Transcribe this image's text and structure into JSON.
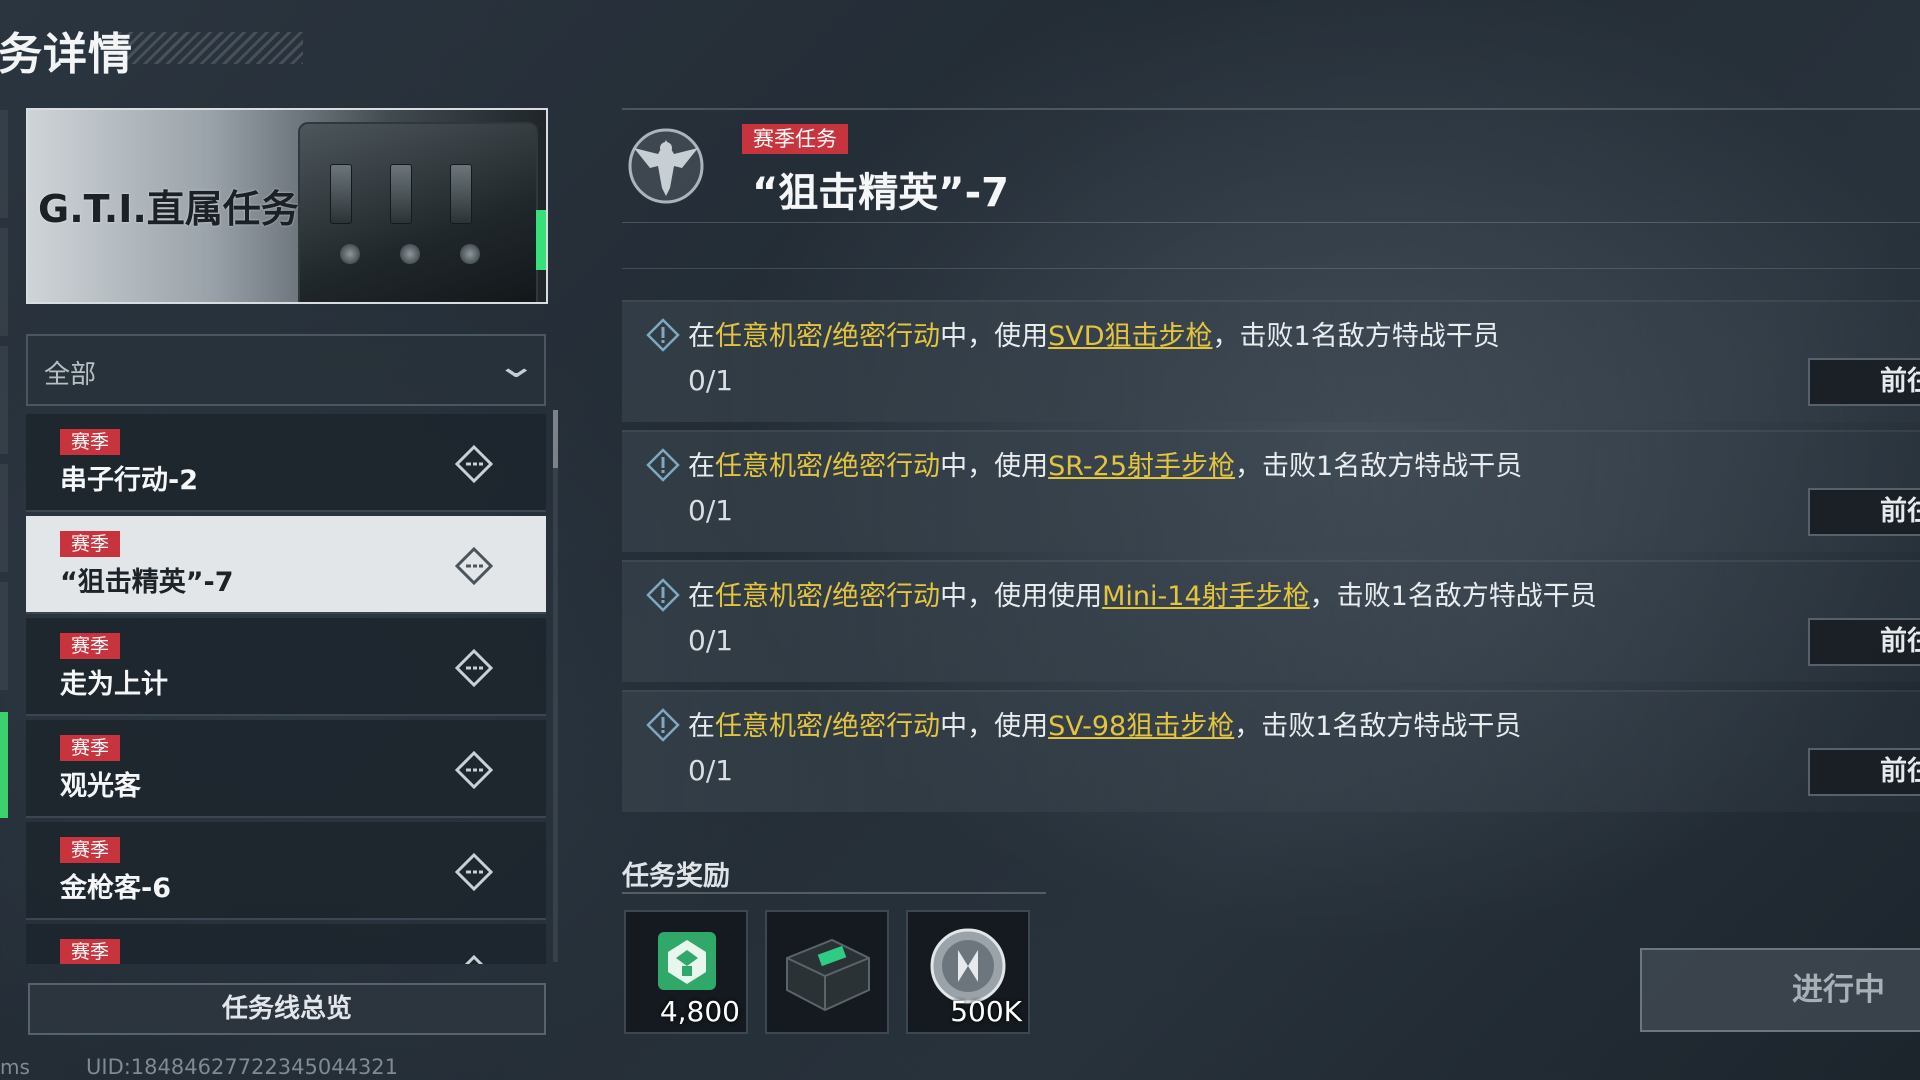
{
  "page": {
    "title": "务详情"
  },
  "banner": {
    "title": "G.T.I.直属任务"
  },
  "filter": {
    "selected": "全部"
  },
  "missions": [
    {
      "badge": "赛季",
      "name": "串子行动-2"
    },
    {
      "badge": "赛季",
      "name": "“狙击精英”-7"
    },
    {
      "badge": "赛季",
      "name": "走为上计"
    },
    {
      "badge": "赛季",
      "name": "观光客"
    },
    {
      "badge": "赛季",
      "name": "金枪客-6"
    },
    {
      "badge": "赛季",
      "name": ""
    }
  ],
  "overview_button": "任务线总览",
  "uid": "UID:18484627722345044321",
  "ms_label": "ms",
  "detail": {
    "badge": "赛季任务",
    "title": "“狙击精英”-7"
  },
  "objectives": [
    {
      "t1": "在",
      "t2": "任意机密/绝密行动",
      "t3": "中，使用",
      "weapon": "SVD狙击步枪",
      "t4": "，击败1名敌方特战干员",
      "progress": "0/1",
      "go": "前往"
    },
    {
      "t1": "在",
      "t2": "任意机密/绝密行动",
      "t3": "中，使用",
      "weapon": "SR-25射手步枪",
      "t4": "，击败1名敌方特战干员",
      "progress": "0/1",
      "go": "前往"
    },
    {
      "t1": "在",
      "t2": "任意机密/绝密行动",
      "t3": "中，使用使用",
      "weapon": "Mini-14射手步枪",
      "t4": "，击败1名敌方特战干员",
      "progress": "0/1",
      "go": "前往"
    },
    {
      "t1": "在",
      "t2": "任意机密/绝密行动",
      "t3": "中，使用",
      "weapon": "SV-98狙击步枪",
      "t4": "，击败1名敌方特战干员",
      "progress": "0/1",
      "go": "前往"
    }
  ],
  "rewards": {
    "title": "任务奖励",
    "items": [
      {
        "icon": "experience-card-icon",
        "count": "4,800"
      },
      {
        "icon": "supply-case-icon",
        "count": ""
      },
      {
        "icon": "silver-coin-icon",
        "count": "500K"
      }
    ]
  },
  "status_button": "进行中",
  "colors": {
    "accent_red": "#c8343d",
    "highlight_yellow": "#e3c43f",
    "active_green": "#3ecf6e"
  }
}
